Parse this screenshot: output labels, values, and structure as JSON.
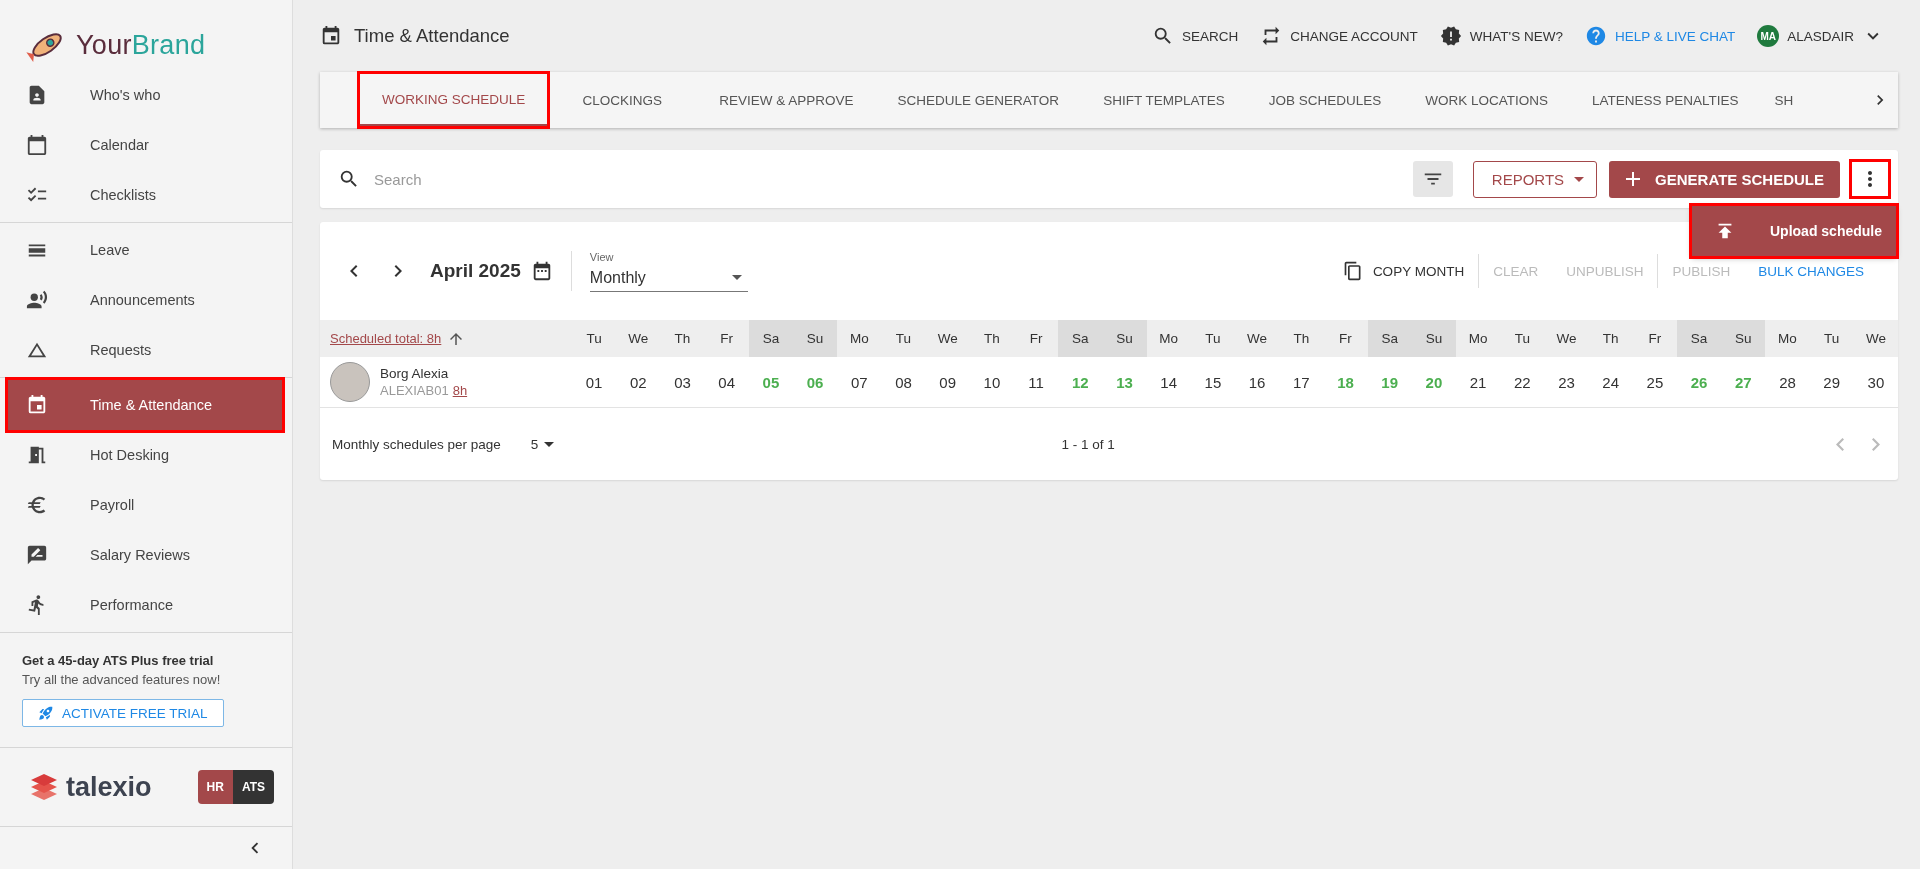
{
  "brand": {
    "name_part_1": "Your",
    "name_part_2": "Brand"
  },
  "sidebar": {
    "groups": [
      [
        {
          "label": "Who's who",
          "selected": false,
          "annotated": false
        },
        {
          "label": "Calendar",
          "selected": false,
          "annotated": false
        },
        {
          "label": "Checklists",
          "selected": false,
          "annotated": false
        }
      ],
      [
        {
          "label": "Leave",
          "selected": false,
          "annotated": false
        },
        {
          "label": "Announcements",
          "selected": false,
          "annotated": false
        },
        {
          "label": "Requests",
          "selected": false,
          "annotated": false
        }
      ],
      [
        {
          "label": "Time & Attendance",
          "selected": true,
          "annotated": true
        },
        {
          "label": "Hot Desking",
          "selected": false,
          "annotated": false
        },
        {
          "label": "Payroll",
          "selected": false,
          "annotated": false
        },
        {
          "label": "Salary Reviews",
          "selected": false,
          "annotated": false
        },
        {
          "label": "Performance",
          "selected": false,
          "annotated": false
        }
      ]
    ],
    "trial": {
      "title": "Get a 45-day ATS Plus free trial",
      "text": "Try all the advanced features now!",
      "button": "ACTIVATE FREE TRIAL"
    },
    "footer_logo": "talexio",
    "modules": [
      {
        "label": "HR",
        "selected": true
      },
      {
        "label": "ATS",
        "selected": false
      }
    ]
  },
  "header": {
    "title": "Time & Attendance",
    "actions": [
      {
        "label": "SEARCH",
        "kind": "plain"
      },
      {
        "label": "CHANGE ACCOUNT",
        "kind": "plain"
      },
      {
        "label": "WHAT'S NEW?",
        "kind": "plain"
      },
      {
        "label": "HELP & LIVE CHAT",
        "kind": "link"
      }
    ],
    "user": {
      "initials": "MA",
      "name": "ALASDAIR"
    }
  },
  "tabs": [
    {
      "label": "WORKING SCHEDULE",
      "selected": true,
      "annotated": true
    },
    {
      "label": "CLOCKINGS",
      "selected": false,
      "annotated": false
    },
    {
      "label": "REVIEW & APPROVE",
      "selected": false,
      "annotated": false
    },
    {
      "label": "SCHEDULE GENERATOR",
      "selected": false,
      "annotated": false
    },
    {
      "label": "SHIFT TEMPLATES",
      "selected": false,
      "annotated": false
    },
    {
      "label": "JOB SCHEDULES",
      "selected": false,
      "annotated": false
    },
    {
      "label": "WORK LOCATIONS",
      "selected": false,
      "annotated": false
    },
    {
      "label": "LATENESS PENALTIES",
      "selected": false,
      "annotated": false
    },
    {
      "label": "SH",
      "selected": false,
      "annotated": false
    }
  ],
  "toolbar": {
    "search": {
      "placeholder": "Search"
    },
    "reports": "REPORTS",
    "generate": "GENERATE SCHEDULE",
    "more_annotated": true,
    "menu": [
      {
        "label": "Upload schedule",
        "annotated": true
      }
    ]
  },
  "calendar": {
    "month": "April 2025",
    "view": {
      "label": "View",
      "value": "Monthly"
    },
    "actions": [
      {
        "label": "COPY MONTH",
        "disabled": false,
        "kind": "primary"
      },
      {
        "label": "CLEAR",
        "disabled": true,
        "kind": "plain"
      },
      {
        "label": "UNPUBLISH",
        "disabled": true,
        "kind": "plain"
      },
      {
        "label": "PUBLISH",
        "disabled": true,
        "kind": "plain"
      },
      {
        "label": "BULK CHANGES",
        "disabled": false,
        "kind": "link"
      }
    ],
    "total_label": "Scheduled total: 8h",
    "days": [
      {
        "name": "Tu",
        "num": "01",
        "weekend": false,
        "off": false
      },
      {
        "name": "We",
        "num": "02",
        "weekend": false,
        "off": false
      },
      {
        "name": "Th",
        "num": "03",
        "weekend": false,
        "off": false
      },
      {
        "name": "Fr",
        "num": "04",
        "weekend": false,
        "off": false
      },
      {
        "name": "Sa",
        "num": "05",
        "weekend": true,
        "off": true
      },
      {
        "name": "Su",
        "num": "06",
        "weekend": true,
        "off": true
      },
      {
        "name": "Mo",
        "num": "07",
        "weekend": false,
        "off": false
      },
      {
        "name": "Tu",
        "num": "08",
        "weekend": false,
        "off": false
      },
      {
        "name": "We",
        "num": "09",
        "weekend": false,
        "off": false
      },
      {
        "name": "Th",
        "num": "10",
        "weekend": false,
        "off": false
      },
      {
        "name": "Fr",
        "num": "11",
        "weekend": false,
        "off": false
      },
      {
        "name": "Sa",
        "num": "12",
        "weekend": true,
        "off": true
      },
      {
        "name": "Su",
        "num": "13",
        "weekend": true,
        "off": true
      },
      {
        "name": "Mo",
        "num": "14",
        "weekend": false,
        "off": false
      },
      {
        "name": "Tu",
        "num": "15",
        "weekend": false,
        "off": false
      },
      {
        "name": "We",
        "num": "16",
        "weekend": false,
        "off": false
      },
      {
        "name": "Th",
        "num": "17",
        "weekend": false,
        "off": false
      },
      {
        "name": "Fr",
        "num": "18",
        "weekend": false,
        "off": true
      },
      {
        "name": "Sa",
        "num": "19",
        "weekend": true,
        "off": true
      },
      {
        "name": "Su",
        "num": "20",
        "weekend": true,
        "off": true
      },
      {
        "name": "Mo",
        "num": "21",
        "weekend": false,
        "off": false
      },
      {
        "name": "Tu",
        "num": "22",
        "weekend": false,
        "off": false
      },
      {
        "name": "We",
        "num": "23",
        "weekend": false,
        "off": false
      },
      {
        "name": "Th",
        "num": "24",
        "weekend": false,
        "off": false
      },
      {
        "name": "Fr",
        "num": "25",
        "weekend": false,
        "off": false
      },
      {
        "name": "Sa",
        "num": "26",
        "weekend": true,
        "off": true
      },
      {
        "name": "Su",
        "num": "27",
        "weekend": true,
        "off": true
      },
      {
        "name": "Mo",
        "num": "28",
        "weekend": false,
        "off": false
      },
      {
        "name": "Tu",
        "num": "29",
        "weekend": false,
        "off": false
      },
      {
        "name": "We",
        "num": "30",
        "weekend": false,
        "off": false
      }
    ],
    "employees": [
      {
        "name": "Borg Alexia",
        "code": "ALEXIAB01",
        "hours": "8h"
      }
    ],
    "footer": {
      "per_page_label": "Monthly schedules per page",
      "per_page": "5",
      "range": "1 - 1 of 1"
    }
  }
}
